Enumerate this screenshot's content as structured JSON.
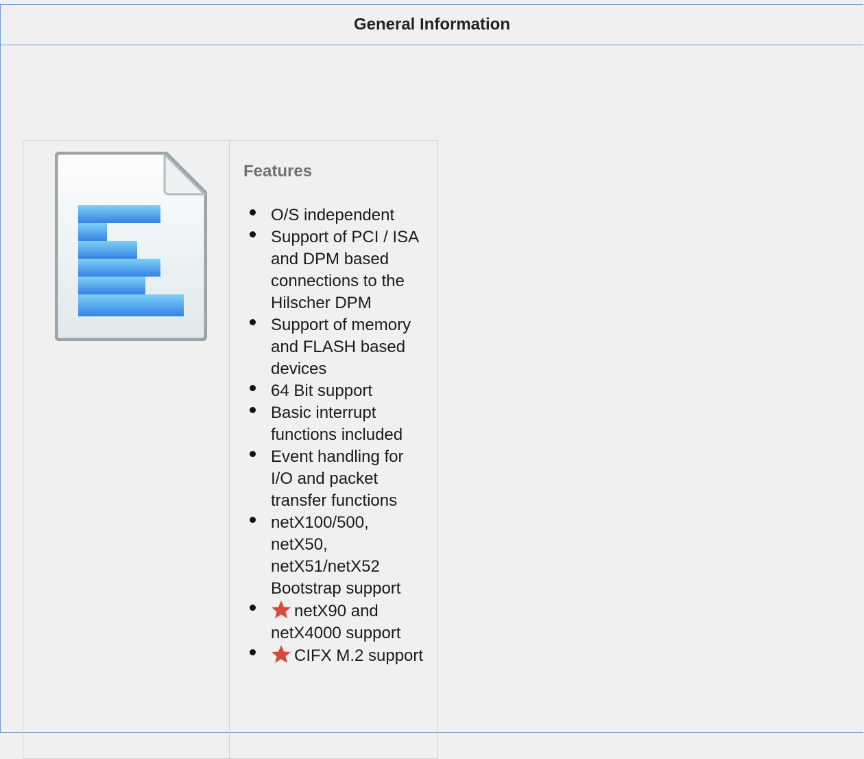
{
  "header": {
    "title": "General Information"
  },
  "features": {
    "title": "Features",
    "items": [
      {
        "text": "O/S independent",
        "star": false
      },
      {
        "text": "Support of PCI / ISA and DPM based connections to the Hilscher DPM",
        "star": false
      },
      {
        "text": "Support of memory and FLASH based devices",
        "star": false
      },
      {
        "text": "64 Bit support",
        "star": false
      },
      {
        "text": "Basic interrupt functions included",
        "star": false
      },
      {
        "text": "Event handling for I/O and packet transfer functions",
        "star": false
      },
      {
        "text": "netX100/500, netX50, netX51/netX52 Bootstrap support",
        "star": false
      },
      {
        "text": "netX90 and netX4000 support",
        "star": true
      },
      {
        "text": "CIFX M.2 support",
        "star": true
      }
    ]
  },
  "icons": {
    "document": "document-icon",
    "star": "star-icon",
    "star_color": "#d94a3c"
  },
  "colors": {
    "panel_border": "#6f9bc9",
    "background": "#f0f0f0",
    "doc_bars": "#3b9bec"
  }
}
